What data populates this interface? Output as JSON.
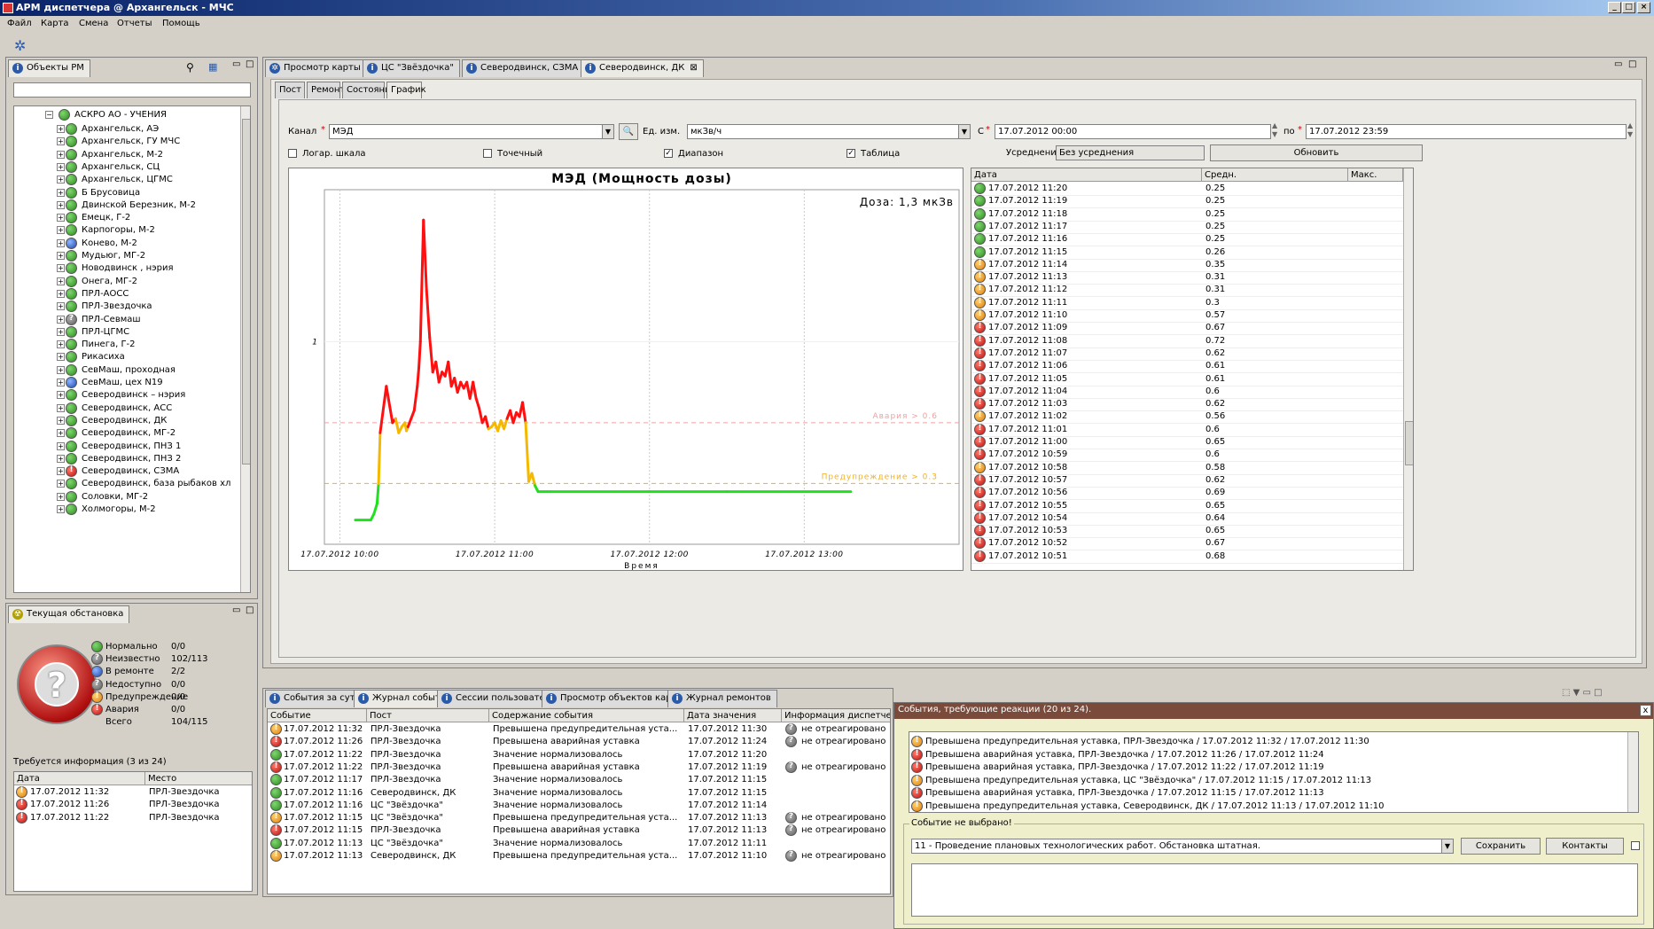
{
  "window": {
    "title": "АРМ диспетчера @ Архангельск - МЧС"
  },
  "menu": [
    "Файл",
    "Карта",
    "Смена",
    "Отчеты",
    "Помощь"
  ],
  "objects_panel": {
    "title": "Объекты РМ",
    "filter": "",
    "root": "АСКРО АО - УЧЕНИЯ",
    "items": [
      {
        "label": "Архангельск,  АЭ",
        "s": "g"
      },
      {
        "label": "Архангельск, ГУ МЧС",
        "s": "g"
      },
      {
        "label": "Архангельск, М-2",
        "s": "g"
      },
      {
        "label": "Архангельск, СЦ",
        "s": "g"
      },
      {
        "label": "Архангельск, ЦГМС",
        "s": "g"
      },
      {
        "label": "Б Брусовица",
        "s": "g"
      },
      {
        "label": "Двинской Березник, М-2",
        "s": "g"
      },
      {
        "label": "Емецк, Г-2",
        "s": "g"
      },
      {
        "label": "Карпогоры, М-2",
        "s": "g"
      },
      {
        "label": "Конево, М-2",
        "s": "b"
      },
      {
        "label": "Мудьюг, МГ-2",
        "s": "g"
      },
      {
        "label": "Новодвинск , нэрия",
        "s": "g"
      },
      {
        "label": "Онега, МГ-2",
        "s": "g"
      },
      {
        "label": "ПРЛ-АОСС",
        "s": "g"
      },
      {
        "label": "ПРЛ-Звездочка",
        "s": "g"
      },
      {
        "label": "ПРЛ-Севмаш",
        "s": "q"
      },
      {
        "label": "ПРЛ-ЦГМС",
        "s": "g"
      },
      {
        "label": "Пинега, Г-2",
        "s": "g"
      },
      {
        "label": "Рикасиха",
        "s": "g"
      },
      {
        "label": "СевМаш, проходная",
        "s": "g"
      },
      {
        "label": "СевМаш, цех N19",
        "s": "b"
      },
      {
        "label": "Северодвинск – нэрия",
        "s": "g"
      },
      {
        "label": "Северодвинск, АСС",
        "s": "g"
      },
      {
        "label": "Северодвинск, ДК",
        "s": "g"
      },
      {
        "label": "Северодвинск, МГ-2",
        "s": "g"
      },
      {
        "label": "Северодвинск, ПНЗ 1",
        "s": "g"
      },
      {
        "label": "Северодвинск, ПНЗ 2",
        "s": "g"
      },
      {
        "label": "Северодвинск, СЗМА",
        "s": "r"
      },
      {
        "label": "Северодвинск, база рыбаков  хл",
        "s": "g"
      },
      {
        "label": "Соловки, МГ-2",
        "s": "g"
      },
      {
        "label": "Холмогоры, М-2",
        "s": "g"
      }
    ]
  },
  "situation": {
    "title": "Текущая обстановка",
    "stats": [
      {
        "label": "Нормально",
        "value": "0/0",
        "s": "g"
      },
      {
        "label": "Неизвестно",
        "value": "102/113",
        "s": "q"
      },
      {
        "label": "В ремонте",
        "value": "2/2",
        "s": "b"
      },
      {
        "label": "Недоступно",
        "value": "0/0",
        "s": "q"
      },
      {
        "label": "Предупреждение",
        "value": "0/0",
        "s": "y"
      },
      {
        "label": "Авария",
        "value": "0/0",
        "s": "r"
      },
      {
        "label": "Всего",
        "value": "104/115",
        "s": ""
      }
    ],
    "info_title": "Требуется информация (3 из 24)",
    "info_cols": [
      "Дата",
      "Место"
    ],
    "info_rows": [
      {
        "s": "y",
        "date": "17.07.2012 11:32",
        "place": "ПРЛ-Звездочка"
      },
      {
        "s": "r",
        "date": "17.07.2012 11:26",
        "place": "ПРЛ-Звездочка"
      },
      {
        "s": "r",
        "date": "17.07.2012 11:22",
        "place": "ПРЛ-Звездочка"
      }
    ]
  },
  "doc_tabs": [
    "Просмотр карты",
    "ЦС \"Звёздочка\"",
    "Северодвинск, СЗМА",
    "Северодвинск, ДК"
  ],
  "sub_tabs": [
    "Пост",
    "Ремонт",
    "Состояние",
    "График"
  ],
  "form": {
    "channel_label": "Канал",
    "channel": "МЭД",
    "unit_label": "Ед. изм.",
    "unit": "мкЗв/ч",
    "from_label": "С",
    "from": "17.07.2012 00:00",
    "to_label": "по",
    "to": "17.07.2012 23:59",
    "log_label": "Логар. шкала",
    "point_label": "Точечный",
    "range_label": "Диапазон",
    "table_label": "Таблица",
    "avg_label": "Усреднение",
    "avg": "Без усреднения",
    "refresh": "Обновить"
  },
  "chart_data": {
    "type": "line",
    "title": "МЭД (Мощность дозы)",
    "annotation": "Доза: 1,3 мкЗв",
    "xlabel": "Время",
    "x_ticks": [
      "17.07.2012 10:00",
      "17.07.2012 11:00",
      "17.07.2012 12:00",
      "17.07.2012 13:00"
    ],
    "y_ticks": [
      "1"
    ],
    "thresholds": [
      {
        "label": "Авария > 0.6",
        "value": 0.6,
        "color": "#f0a0a0"
      },
      {
        "label": "Предупреждение > 0.3",
        "value": 0.3,
        "color": "#f0b020"
      }
    ],
    "series": [
      {
        "x": [
          10.1,
          10.2,
          10.22,
          10.24,
          10.25,
          10.26,
          10.3,
          10.34,
          10.36,
          10.38,
          10.4,
          10.42,
          10.43,
          10.44,
          10.46,
          10.48,
          10.5,
          10.51,
          10.52,
          10.54,
          10.56,
          10.58,
          10.6,
          10.62,
          10.64,
          10.66,
          10.68,
          10.7,
          10.72,
          10.74,
          10.76,
          10.78,
          10.8,
          10.82,
          10.84,
          10.86,
          10.88,
          10.9,
          10.92,
          10.94,
          10.96,
          10.98,
          11.0,
          11.02,
          11.04,
          11.06,
          11.08,
          11.1,
          11.12,
          11.14,
          11.16,
          11.18,
          11.2,
          11.22,
          11.24,
          11.26,
          11.28,
          11.3,
          11.32,
          11.34,
          11.36,
          12.0,
          12.5,
          13.3
        ],
        "y": [
          0.12,
          0.12,
          0.15,
          0.2,
          0.3,
          0.55,
          0.78,
          0.6,
          0.62,
          0.55,
          0.58,
          0.6,
          0.56,
          0.58,
          0.62,
          0.66,
          0.78,
          0.87,
          1.0,
          1.6,
          1.25,
          1.02,
          0.85,
          0.9,
          0.8,
          0.85,
          0.83,
          0.9,
          0.78,
          0.82,
          0.75,
          0.8,
          0.77,
          0.8,
          0.72,
          0.8,
          0.72,
          0.67,
          0.6,
          0.63,
          0.57,
          0.58,
          0.6,
          0.56,
          0.61,
          0.57,
          0.62,
          0.66,
          0.6,
          0.65,
          0.63,
          0.7,
          0.6,
          0.31,
          0.35,
          0.29,
          0.26,
          0.26,
          0.26,
          0.26,
          0.26,
          0.26,
          0.26,
          0.26
        ],
        "name": ""
      }
    ]
  },
  "data_table": {
    "cols": [
      "Дата",
      "Средн.",
      "Макс."
    ],
    "rows": [
      {
        "s": "g",
        "d": "17.07.2012 11:20",
        "v": "0.25"
      },
      {
        "s": "g",
        "d": "17.07.2012 11:19",
        "v": "0.25"
      },
      {
        "s": "g",
        "d": "17.07.2012 11:18",
        "v": "0.25"
      },
      {
        "s": "g",
        "d": "17.07.2012 11:17",
        "v": "0.25"
      },
      {
        "s": "g",
        "d": "17.07.2012 11:16",
        "v": "0.25"
      },
      {
        "s": "g",
        "d": "17.07.2012 11:15",
        "v": "0.26"
      },
      {
        "s": "y",
        "d": "17.07.2012 11:14",
        "v": "0.35"
      },
      {
        "s": "y",
        "d": "17.07.2012 11:13",
        "v": "0.31"
      },
      {
        "s": "y",
        "d": "17.07.2012 11:12",
        "v": "0.31"
      },
      {
        "s": "y",
        "d": "17.07.2012 11:11",
        "v": "0.3"
      },
      {
        "s": "y",
        "d": "17.07.2012 11:10",
        "v": "0.57"
      },
      {
        "s": "r",
        "d": "17.07.2012 11:09",
        "v": "0.67"
      },
      {
        "s": "r",
        "d": "17.07.2012 11:08",
        "v": "0.72"
      },
      {
        "s": "r",
        "d": "17.07.2012 11:07",
        "v": "0.62"
      },
      {
        "s": "r",
        "d": "17.07.2012 11:06",
        "v": "0.61"
      },
      {
        "s": "r",
        "d": "17.07.2012 11:05",
        "v": "0.61"
      },
      {
        "s": "r",
        "d": "17.07.2012 11:04",
        "v": "0.6"
      },
      {
        "s": "r",
        "d": "17.07.2012 11:03",
        "v": "0.62"
      },
      {
        "s": "y",
        "d": "17.07.2012 11:02",
        "v": "0.56"
      },
      {
        "s": "r",
        "d": "17.07.2012 11:01",
        "v": "0.6"
      },
      {
        "s": "r",
        "d": "17.07.2012 11:00",
        "v": "0.65"
      },
      {
        "s": "r",
        "d": "17.07.2012 10:59",
        "v": "0.6"
      },
      {
        "s": "y",
        "d": "17.07.2012 10:58",
        "v": "0.58"
      },
      {
        "s": "r",
        "d": "17.07.2012 10:57",
        "v": "0.62"
      },
      {
        "s": "r",
        "d": "17.07.2012 10:56",
        "v": "0.69"
      },
      {
        "s": "r",
        "d": "17.07.2012 10:55",
        "v": "0.65"
      },
      {
        "s": "r",
        "d": "17.07.2012 10:54",
        "v": "0.64"
      },
      {
        "s": "r",
        "d": "17.07.2012 10:53",
        "v": "0.65"
      },
      {
        "s": "r",
        "d": "17.07.2012 10:52",
        "v": "0.67"
      },
      {
        "s": "r",
        "d": "17.07.2012 10:51",
        "v": "0.68"
      }
    ]
  },
  "bottom_tabs": [
    "События за сутки",
    "Журнал событий",
    "Сессии пользователей",
    "Просмотр объектов карты",
    "Журнал ремонтов"
  ],
  "events": {
    "cols": [
      "Событие",
      "Пост",
      "Содержание события",
      "Дата значения",
      "Информация диспетчера"
    ],
    "rows": [
      {
        "s": "y",
        "d": "17.07.2012 11:32",
        "p": "ПРЛ-Звездочка",
        "c": "Превышена предупредительная уста...",
        "v": "17.07.2012 11:30",
        "i": "не отреагировано !"
      },
      {
        "s": "r",
        "d": "17.07.2012 11:26",
        "p": "ПРЛ-Звездочка",
        "c": "Превышена аварийная уставка",
        "v": "17.07.2012 11:24",
        "i": "не отреагировано !"
      },
      {
        "s": "g",
        "d": "17.07.2012 11:22",
        "p": "ПРЛ-Звездочка",
        "c": "Значение нормализовалось",
        "v": "17.07.2012 11:20",
        "i": ""
      },
      {
        "s": "r",
        "d": "17.07.2012 11:22",
        "p": "ПРЛ-Звездочка",
        "c": "Превышена аварийная уставка",
        "v": "17.07.2012 11:19",
        "i": "не отреагировано !"
      },
      {
        "s": "g",
        "d": "17.07.2012 11:17",
        "p": "ПРЛ-Звездочка",
        "c": "Значение нормализовалось",
        "v": "17.07.2012 11:15",
        "i": ""
      },
      {
        "s": "g",
        "d": "17.07.2012 11:16",
        "p": "Северодвинск, ДК",
        "c": "Значение нормализовалось",
        "v": "17.07.2012 11:15",
        "i": ""
      },
      {
        "s": "g",
        "d": "17.07.2012 11:16",
        "p": "ЦС \"Звёздочка\"",
        "c": "Значение нормализовалось",
        "v": "17.07.2012 11:14",
        "i": ""
      },
      {
        "s": "y",
        "d": "17.07.2012 11:15",
        "p": "ЦС \"Звёздочка\"",
        "c": "Превышена предупредительная уста...",
        "v": "17.07.2012 11:13",
        "i": "не отреагировано !"
      },
      {
        "s": "r",
        "d": "17.07.2012 11:15",
        "p": "ПРЛ-Звездочка",
        "c": "Превышена аварийная уставка",
        "v": "17.07.2012 11:13",
        "i": "не отреагировано !"
      },
      {
        "s": "g",
        "d": "17.07.2012 11:13",
        "p": "ЦС \"Звёздочка\"",
        "c": "Значение нормализовалось",
        "v": "17.07.2012 11:11",
        "i": ""
      },
      {
        "s": "y",
        "d": "17.07.2012 11:13",
        "p": "Северодвинск, ДК",
        "c": "Превышена предупредительная уста...",
        "v": "17.07.2012 11:10",
        "i": "не отреагировано !"
      }
    ]
  },
  "popup": {
    "title": "События, требующие реакции (20 из 24).",
    "items": [
      {
        "s": "y",
        "t": "Превышена предупредительная уставка, ПРЛ-Звездочка / 17.07.2012 11:32 / 17.07.2012 11:30"
      },
      {
        "s": "r",
        "t": "Превышена аварийная уставка, ПРЛ-Звездочка / 17.07.2012 11:26 / 17.07.2012 11:24"
      },
      {
        "s": "r",
        "t": "Превышена аварийная уставка, ПРЛ-Звездочка / 17.07.2012 11:22 / 17.07.2012 11:19"
      },
      {
        "s": "y",
        "t": "Превышена предупредительная уставка, ЦС \"Звёздочка\" / 17.07.2012 11:15 / 17.07.2012 11:13"
      },
      {
        "s": "r",
        "t": "Превышена аварийная уставка, ПРЛ-Звездочка / 17.07.2012 11:15 / 17.07.2012 11:13"
      },
      {
        "s": "y",
        "t": "Превышена предупредительная уставка, Северодвинск, ДК / 17.07.2012 11:13 / 17.07.2012 11:10"
      }
    ],
    "group_label": "Событие не выбрано!",
    "select": "11 - Проведение плановых технологических работ. Обстановка штатная.",
    "save": "Сохранить",
    "contacts": "Контакты"
  }
}
